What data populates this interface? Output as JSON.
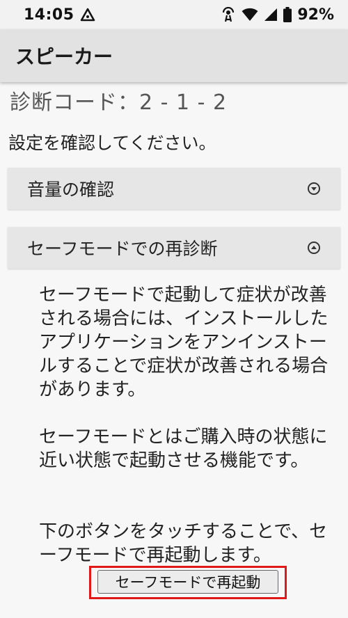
{
  "status_bar": {
    "time": "14:05",
    "battery": "92%",
    "icons": [
      "alert-triangle-icon",
      "hotspot-icon",
      "wifi-icon",
      "signal-icon",
      "battery-icon"
    ]
  },
  "app_bar": {
    "title": "スピーカー"
  },
  "diagnosis": {
    "code": "診断コード：2 - 1 - 2"
  },
  "instruction": "設定を確認してください。",
  "accordions": [
    {
      "label": "音量の確認",
      "state": "collapsed",
      "icon": "chevron-down-circle-icon"
    },
    {
      "label": "セーフモードでの再診断",
      "state": "expanded",
      "icon": "chevron-up-circle-icon"
    }
  ],
  "content": {
    "paragraph1": "セーフモードで起動して症状が改善される場合には、インストールしたアプリケーションをアンインストールすることで症状が改善される場合があります。",
    "paragraph2": "セーフモードとはご購入時の状態に近い状態で起動させる機能です。",
    "paragraph3": "下のボタンをタッチすることで、セーフモードで再起動します。"
  },
  "restart_button": {
    "label": "セーフモードで再起動"
  },
  "colors": {
    "highlight": "#e01818",
    "app_bar": "#e2e2e2",
    "background": "#f7f7f7"
  }
}
